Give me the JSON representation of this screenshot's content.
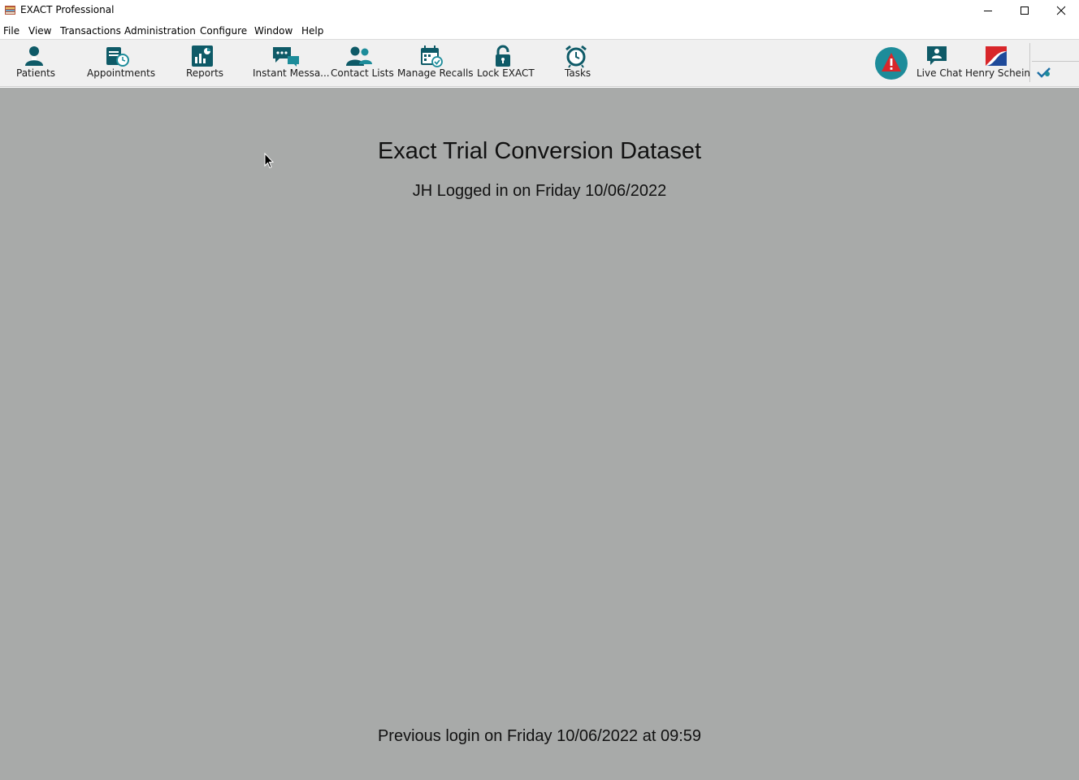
{
  "window": {
    "title": "EXACT Professional",
    "controls": [
      "minimize",
      "maximize",
      "close"
    ]
  },
  "menu": [
    {
      "label": "File"
    },
    {
      "label": "View"
    },
    {
      "label": "Transactions"
    },
    {
      "label": "Administration"
    },
    {
      "label": "Configure"
    },
    {
      "label": "Window"
    },
    {
      "label": "Help"
    }
  ],
  "toolbar": {
    "buttons": [
      {
        "label": "Patients",
        "icon": "patient-icon",
        "dropdown": true
      },
      {
        "label": "Appointments",
        "icon": "appointments-icon",
        "dropdown": true
      },
      {
        "label": "Reports",
        "icon": "reports-icon",
        "dropdown": true
      },
      {
        "label": "Instant Messa...",
        "icon": "instant-message-icon",
        "dropdown": false
      },
      {
        "label": "Contact Lists",
        "icon": "contact-lists-icon",
        "dropdown": false
      },
      {
        "label": "Manage Recalls",
        "icon": "calendar-recall-icon",
        "dropdown": false
      },
      {
        "label": "Lock EXACT",
        "icon": "lock-icon",
        "dropdown": false
      },
      {
        "label": "Tasks",
        "icon": "alarm-clock-icon",
        "dropdown": true
      }
    ],
    "right_buttons": [
      {
        "label": "",
        "icon": "alert-warning-icon"
      },
      {
        "label": "Live Chat",
        "icon": "live-chat-icon"
      },
      {
        "label": "Henry Schein",
        "icon": "henry-schein-logo-icon"
      },
      {
        "label": "",
        "icon": "checkmark-icon"
      }
    ]
  },
  "main": {
    "dataset_title": "Exact Trial Conversion Dataset",
    "login_text": "JH Logged in on Friday 10/06/2022",
    "previous_login_text": "Previous login on Friday 10/06/2022 at 09:59"
  },
  "colors": {
    "background": "#a8aaa9",
    "toolbar": "#f0f0f0",
    "icon_teal": "#0e5a67",
    "alert_red": "#d8262a",
    "alert_circle": "#1d8c9a"
  }
}
